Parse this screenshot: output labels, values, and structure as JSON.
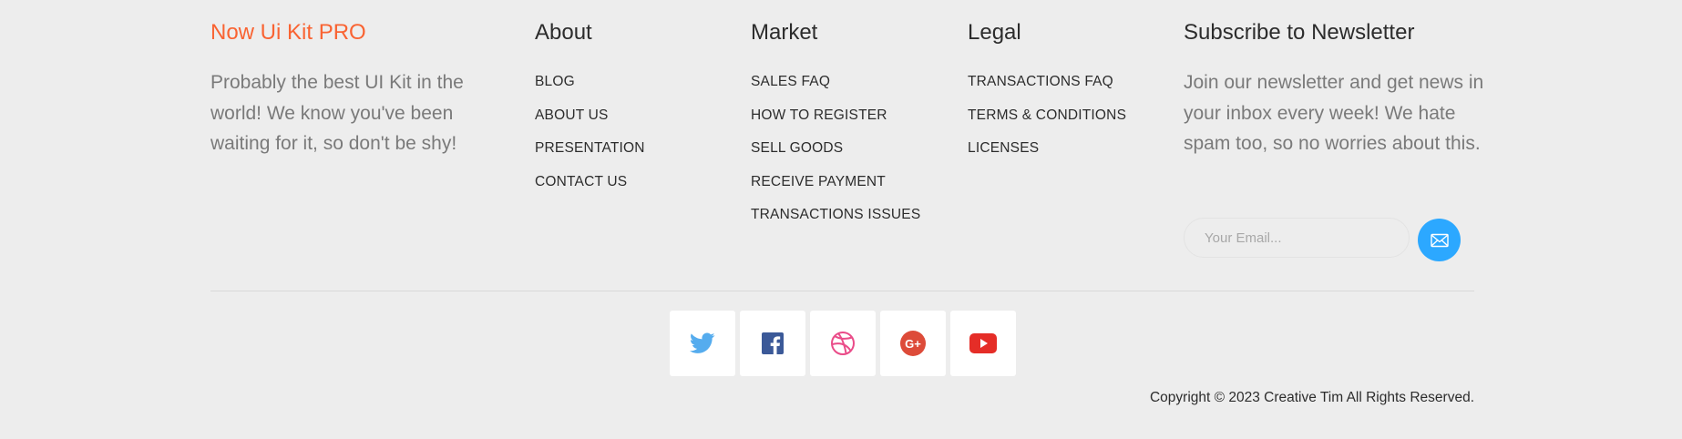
{
  "brand": {
    "title": "Now Ui Kit PRO",
    "description": "Probably the best UI Kit in the world! We know you've been waiting for it, so don't be shy!",
    "color": "#f96332"
  },
  "about": {
    "title": "About",
    "links": [
      "BLOG",
      "ABOUT US",
      "PRESENTATION",
      "CONTACT US"
    ]
  },
  "market": {
    "title": "Market",
    "links": [
      "SALES FAQ",
      "HOW TO REGISTER",
      "SELL GOODS",
      "RECEIVE PAYMENT",
      "TRANSACTIONS ISSUES"
    ]
  },
  "legal": {
    "title": "Legal",
    "links": [
      "TRANSACTIONS FAQ",
      "TERMS & CONDITIONS",
      "LICENSES"
    ]
  },
  "newsletter": {
    "title": "Subscribe to Newsletter",
    "description": "Join our newsletter and get news in your inbox every week! We hate spam too, so no worries about this.",
    "email_placeholder": "Your Email...",
    "email_value": "",
    "send_icon": "envelope-icon",
    "button_color": "#2ca8ff"
  },
  "social": [
    {
      "name": "twitter",
      "icon": "twitter-icon",
      "color": "#55acee"
    },
    {
      "name": "facebook",
      "icon": "facebook-icon",
      "color": "#3b5998"
    },
    {
      "name": "dribbble",
      "icon": "dribbble-icon",
      "color": "#ea4c89"
    },
    {
      "name": "google-plus",
      "icon": "google-plus-icon",
      "color": "#dd4b39"
    },
    {
      "name": "youtube",
      "icon": "youtube-icon",
      "color": "#e52d27"
    }
  ],
  "copyright": "Copyright © 2023 Creative Tim All Rights Reserved."
}
